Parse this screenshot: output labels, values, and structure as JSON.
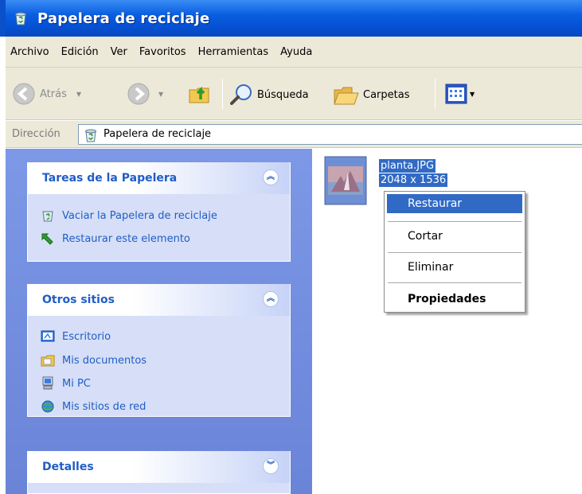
{
  "window": {
    "title": "Papelera de reciclaje"
  },
  "menu": [
    "Archivo",
    "Edición",
    "Ver",
    "Favoritos",
    "Herramientas",
    "Ayuda"
  ],
  "toolbar": {
    "back_label": "Atrás",
    "search_label": "Búsqueda",
    "folders_label": "Carpetas"
  },
  "address": {
    "label": "Dirección",
    "value": "Papelera de reciclaje"
  },
  "panels": {
    "tasks": {
      "title": "Tareas de la Papelera",
      "items": [
        "Vaciar la Papelera de reciclaje",
        "Restaurar este elemento"
      ]
    },
    "other": {
      "title": "Otros sitios",
      "items": [
        "Escritorio",
        "Mis documentos",
        "Mi PC",
        "Mis sitios de red"
      ]
    },
    "details": {
      "title": "Detalles"
    }
  },
  "file": {
    "name": "planta.JPG",
    "dimensions": "2048 x 1536"
  },
  "context_menu": {
    "items": [
      "Restaurar",
      "Cortar",
      "Eliminar",
      "Propiedades"
    ]
  },
  "colors": {
    "title_bar": "#0a5ee0",
    "selection": "#316ac5",
    "task_link": "#215dc6",
    "left_pane": "#7c98e6"
  }
}
